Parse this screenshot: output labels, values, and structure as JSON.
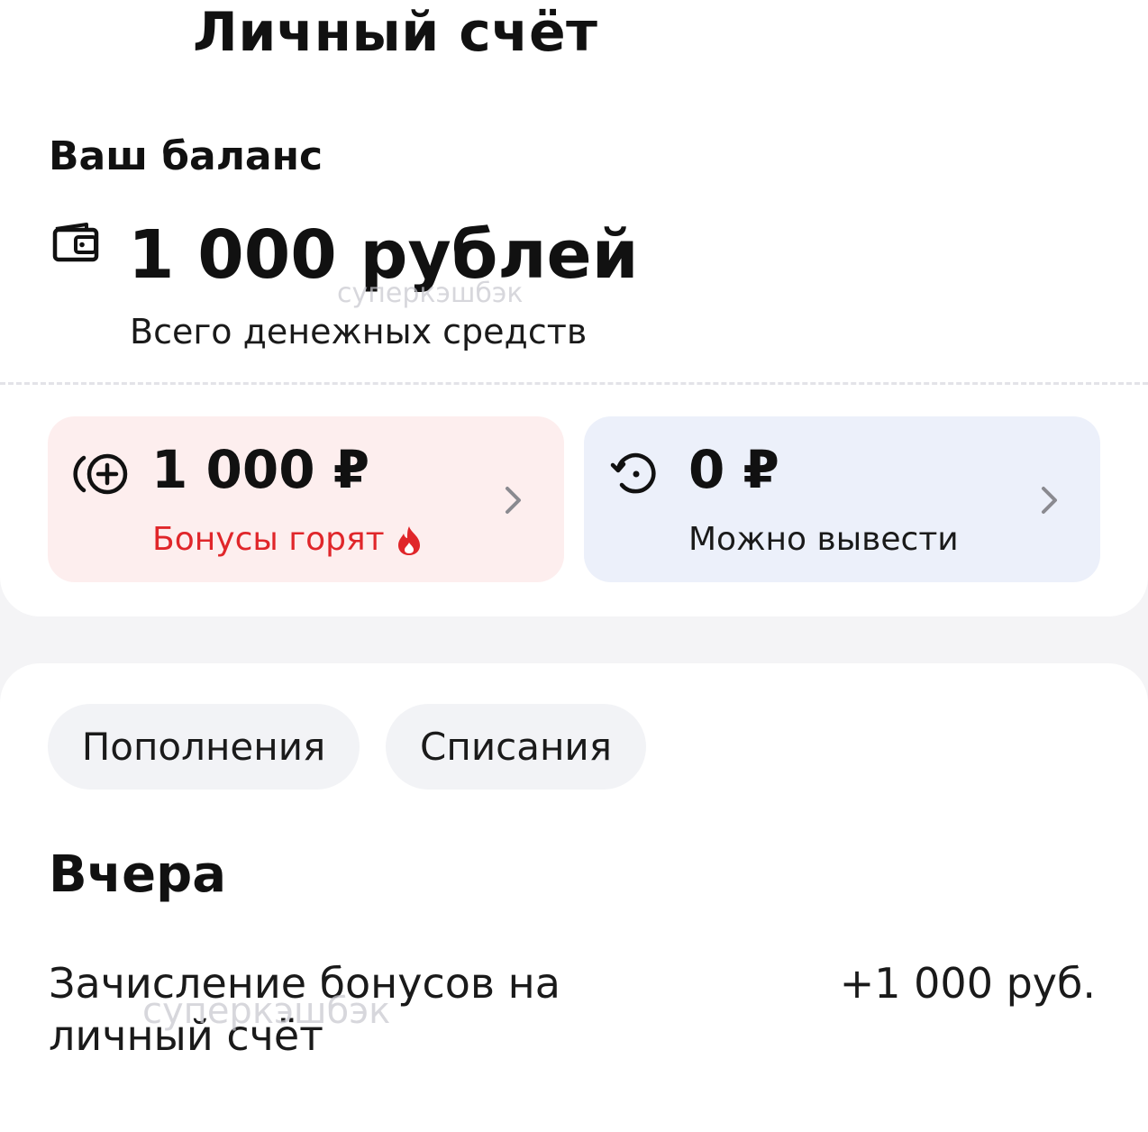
{
  "header": {
    "title": "Личный счёт"
  },
  "balance": {
    "heading": "Ваш баланс",
    "amount": "1 000 рублей",
    "subtitle": "Всего денежных средств",
    "icon": "wallet-icon"
  },
  "tiles": {
    "bonus": {
      "amount": "1 000 ₽",
      "label": "Бонусы горят",
      "icon": "bonus-coin-icon",
      "status_icon": "fire-icon",
      "accent_color": "#e0262a",
      "background": "#fdeeee"
    },
    "withdraw": {
      "amount": "0 ₽",
      "label": "Можно вывести",
      "icon": "history-icon",
      "background": "#ecf0fa"
    }
  },
  "filters": {
    "replenish_label": "Пополнения",
    "debit_label": "Списания"
  },
  "history": {
    "date_heading": "Вчера",
    "transactions": [
      {
        "description": "Зачисление бонусов на личный счёт",
        "amount": "+1 000 руб."
      }
    ]
  },
  "watermark": {
    "text": "суперкэшбэк"
  }
}
